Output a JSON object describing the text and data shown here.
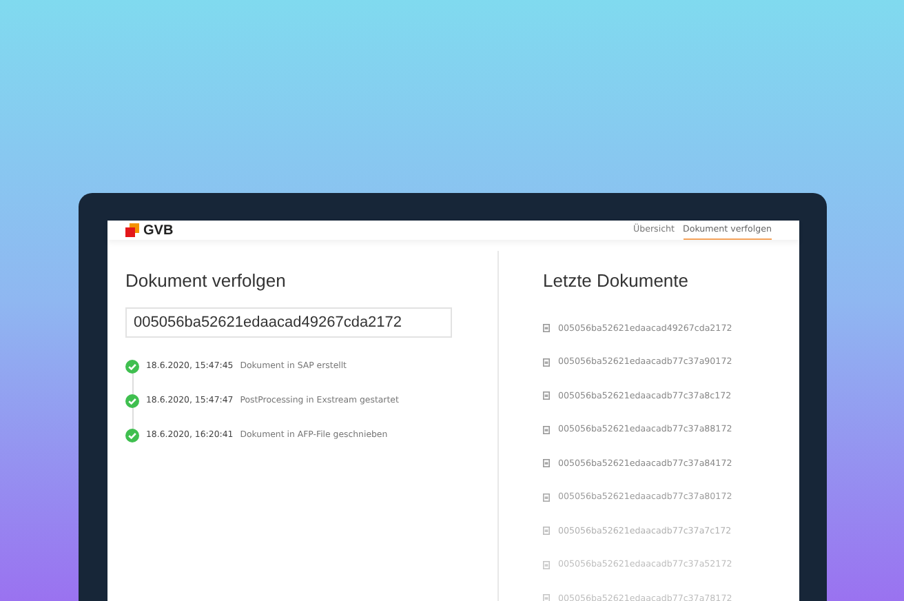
{
  "header": {
    "logo": "GVB",
    "nav": [
      {
        "label": "Übersicht",
        "selected": false
      },
      {
        "label": "Dokument verfolgen",
        "selected": true
      }
    ]
  },
  "tracking": {
    "title": "Dokument verfolgen",
    "document_id": "005056ba52621edaacad49267cda2172",
    "events": [
      {
        "time": "18.6.2020, 15:47:45",
        "text": "Dokument in SAP erstellt",
        "done": true
      },
      {
        "time": "18.6.2020, 15:47:47",
        "text": "PostProcessing in Exstream gestartet",
        "done": true
      },
      {
        "time": "18.6.2020, 16:20:41",
        "text": "Dokument in AFP-File geschnieben",
        "done": true
      }
    ]
  },
  "recent": {
    "title": "Letzte Dokumente",
    "items": [
      "005056ba52621edaacad49267cda2172",
      "005056ba52621edaacadb77c37a90172",
      "005056ba52621edaacadb77c37a8c172",
      "005056ba52621edaacadb77c37a88172",
      "005056ba52621edaacadb77c37a84172",
      "005056ba52621edaacadb77c37a80172",
      "005056ba52621edaacadb77c37a7c172",
      "005056ba52621edaacadb77c37a52172",
      "005056ba52621edaacadb77c37a78172"
    ]
  }
}
